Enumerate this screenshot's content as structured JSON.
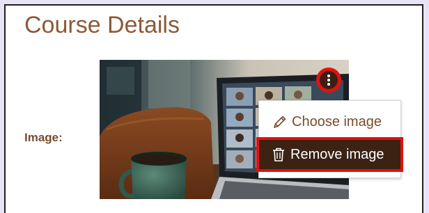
{
  "section": {
    "title": "Course Details"
  },
  "image_field": {
    "label": "Image:",
    "image_description_icon": "video-call-laptop-photo"
  },
  "options_button": {
    "icon": "kebab-icon"
  },
  "menu": {
    "items": [
      {
        "label": "Choose image",
        "icon": "pencil-icon"
      },
      {
        "label": "Remove image",
        "icon": "trash-icon"
      }
    ]
  },
  "colors": {
    "accent_brown": "#8b5a36",
    "highlight_red": "#e0120f",
    "dark_brown": "#3b2212"
  }
}
